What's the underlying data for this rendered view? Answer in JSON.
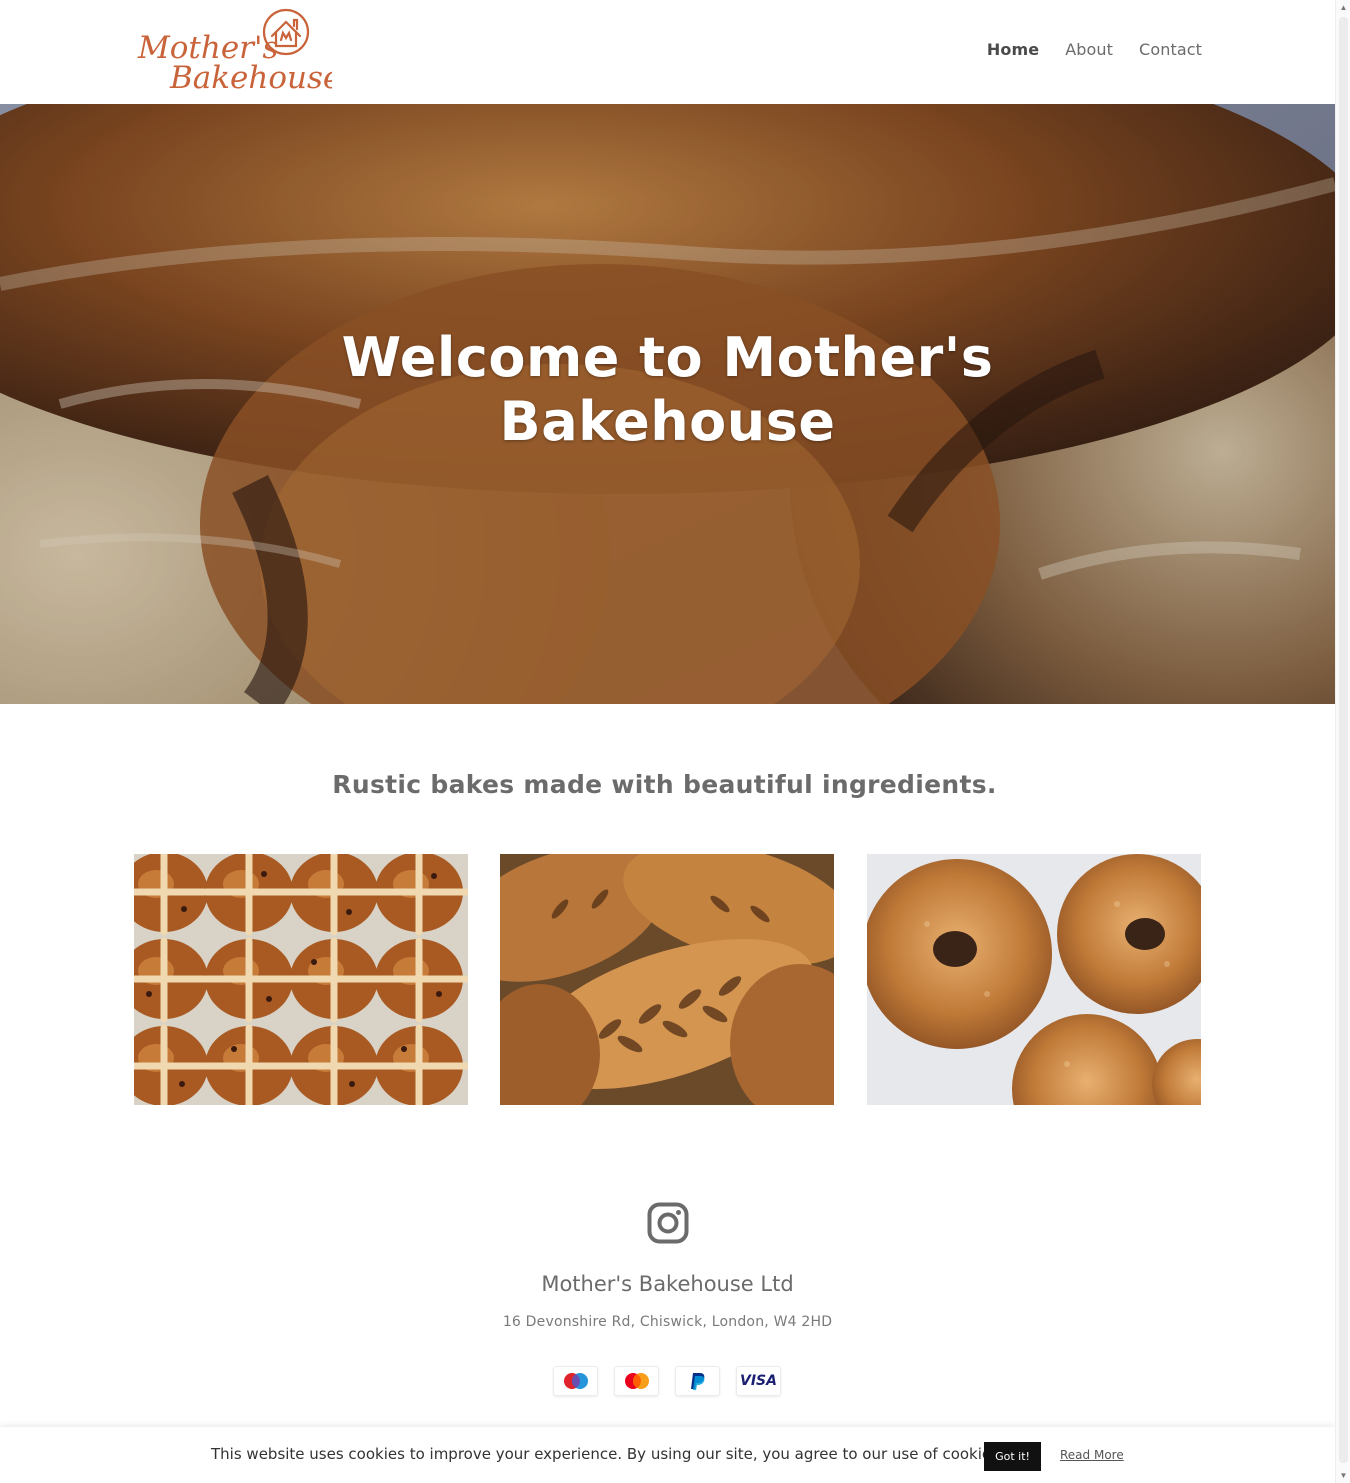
{
  "header": {
    "logo_line1": "Mother's",
    "logo_line2": "Bakehouse",
    "nav": [
      {
        "label": "Home",
        "active": true
      },
      {
        "label": "About",
        "active": false
      },
      {
        "label": "Contact",
        "active": false
      }
    ]
  },
  "hero": {
    "title_line1": "Welcome to Mother's",
    "title_line2": "Bakehouse"
  },
  "tagline": "Rustic bakes made with beautiful ingredients.",
  "gallery": [
    {
      "subject": "hot cross buns"
    },
    {
      "subject": "fougasse loaves"
    },
    {
      "subject": "bagels"
    }
  ],
  "footer": {
    "social_icon": "instagram-icon",
    "company": "Mother's Bakehouse Ltd",
    "address": "16 Devonshire Rd, Chiswick, London, W4 2HD",
    "payments": [
      "maestro-icon",
      "mastercard-icon",
      "paypal-icon",
      "visa-icon"
    ],
    "visa_label": "VISA"
  },
  "cookie": {
    "text": "This website uses cookies to improve your experience. By using our site, you agree to our use of cookies.",
    "button": "Got it!",
    "link": "Read More"
  },
  "colors": {
    "logo": "#c9633a",
    "text": "#6b6b6b",
    "button": "#111111"
  }
}
